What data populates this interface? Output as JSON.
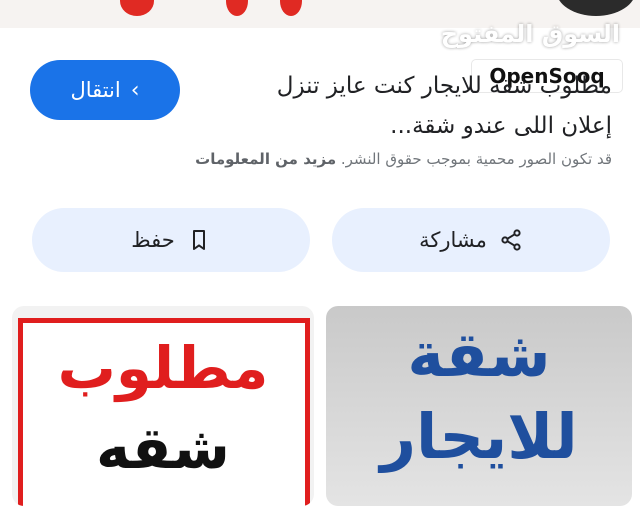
{
  "watermark": "السوق المفتوح",
  "brand": "OpenSooq",
  "result": {
    "description": "مطلوب شقه للايجار كنت عايز تنزل إعلان اللى عندو شقة...",
    "visit_label": "انتقال",
    "copyright_notice": "قد تكون الصور محمية بموجب حقوق النشر.",
    "more_info_label": "مزيد من المعلومات"
  },
  "actions": {
    "share_label": "مشاركة",
    "save_label": "حفظ"
  },
  "thumbnails": [
    {
      "line1": "مطلوب",
      "line2": "شقه"
    },
    {
      "line1": "شقة",
      "line2": "للايجار"
    }
  ],
  "colors": {
    "accent": "#1a73e8",
    "action_bg": "#e8f0fe",
    "red": "#e01e1e",
    "blue_text": "#1f4f9e"
  }
}
